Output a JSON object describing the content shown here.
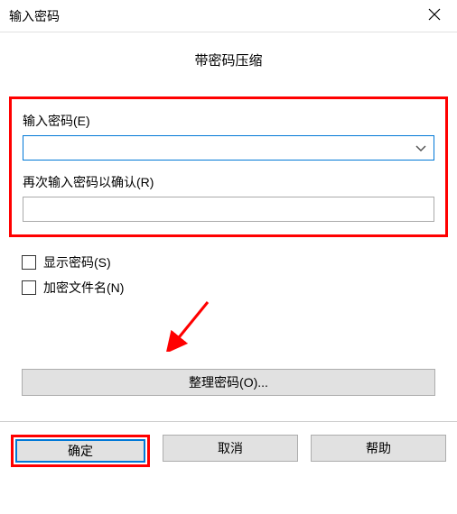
{
  "titlebar": {
    "title": "输入密码"
  },
  "heading": "带密码压缩",
  "fields": {
    "password_label": "输入密码(E)",
    "password_value": "",
    "confirm_label": "再次输入密码以确认(R)",
    "confirm_value": ""
  },
  "checkboxes": {
    "show_password": "显示密码(S)",
    "encrypt_filenames": "加密文件名(N)"
  },
  "buttons": {
    "organize": "整理密码(O)...",
    "ok": "确定",
    "cancel": "取消",
    "help": "帮助"
  }
}
